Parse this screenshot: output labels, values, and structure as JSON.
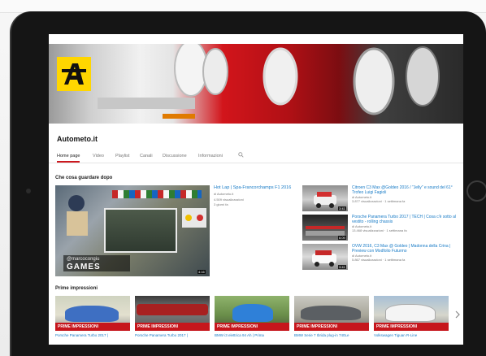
{
  "channel": {
    "name": "Autometo.it"
  },
  "tabs": [
    {
      "label": "Home page"
    },
    {
      "label": "Video"
    },
    {
      "label": "Playlist"
    },
    {
      "label": "Canali"
    },
    {
      "label": "Discussione"
    },
    {
      "label": "Informazioni"
    }
  ],
  "section_watch": {
    "title": "Che cosa guardare dopo"
  },
  "featured": {
    "title": "Hot Lap | Spa-Francorchamps F1 2016",
    "channel": "di Autometo.it",
    "views": "4.509 visualizzazioni",
    "age": "3 giorni fa",
    "overlay_handle": "@marcocongiu",
    "overlay_title": "GAMES",
    "duration": "4:16"
  },
  "side_videos": [
    {
      "title": "Citroen C3 Max @Goldeo 2016 / \"Jelly\" e sound del 61° Trofeo Luigi Fagioli",
      "channel": "di Autometo.it",
      "meta": "3.877 visualizzazioni · 1 settimana fa",
      "duration": "3:41"
    },
    {
      "title": "Porsche Panamera Turbo 2017 | TECH | Cosa c'è sotto al vestito - rolling chassis",
      "channel": "di Autometo.it",
      "meta": "13.468 visualizzazioni · 1 settimana fa",
      "duration": "6:09"
    },
    {
      "title": "OVW 2016, C3 Max @ Goldeo | Madonna della Crina | Preview con Modfolio Futurmo",
      "channel": "di Autometo.it",
      "meta": "5.867 visualizzazioni · 1 settimana fa",
      "duration": "3:41"
    }
  ],
  "section_first": {
    "title": "Prime impressioni"
  },
  "first_impressions": [
    {
      "badge": "PRIME IMPRESSIONI",
      "title": "Porsche Panamera Turbo 2017 |"
    },
    {
      "badge": "PRIME IMPRESSIONI",
      "title": "Porsche Panamera Turbo 2017 |"
    },
    {
      "badge": "PRIME IMPRESSIONI",
      "title": "BMW i3 elettrica 94 Ah | Prima"
    },
    {
      "badge": "PRIME IMPRESSIONI",
      "title": "BMW Serie 7 Ibrida plug-in 740Le"
    },
    {
      "badge": "PRIME IMPRESSIONI",
      "title": "Volkswagen Tiguan R-Line"
    }
  ],
  "colors": {
    "youtube_red": "#cc181e",
    "link_blue": "#167ac6",
    "logo_yellow": "#ffd600",
    "badge_red": "#c6161c"
  },
  "icons": [
    "search-icon",
    "chevron-right-icon",
    "autometo-logo"
  ]
}
